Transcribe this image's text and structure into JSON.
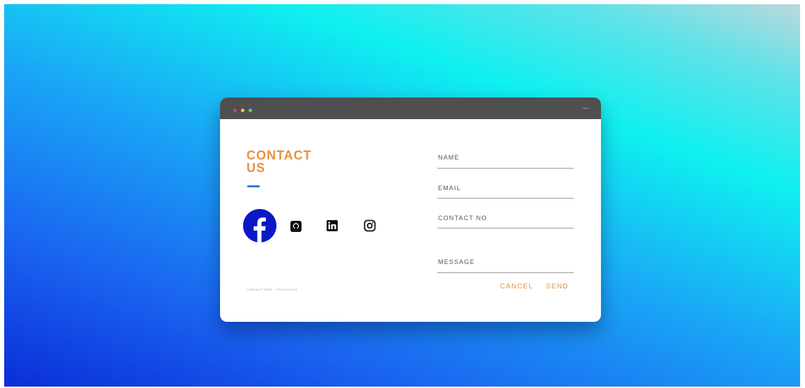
{
  "window": {
    "title_dots": [
      "red",
      "yellow",
      "green"
    ]
  },
  "contact": {
    "heading_line1": "CONTACT",
    "heading_line2": "US",
    "info_text": "CONTACT INFO : +91XXXXXXX"
  },
  "social": [
    {
      "name": "facebook",
      "icon": "facebook-icon"
    },
    {
      "name": "github",
      "icon": "github-icon"
    },
    {
      "name": "linkedin",
      "icon": "linkedin-icon"
    },
    {
      "name": "instagram",
      "icon": "instagram-icon"
    }
  ],
  "form": {
    "name_label": "NAME",
    "email_label": "EMAIL",
    "contact_label": "CONTACT NO",
    "message_label": "MESSAGE",
    "cancel_label": "CANCEL",
    "send_label": "SEND"
  },
  "colors": {
    "accent": "#e8913c",
    "titlebar": "#4f4f4f",
    "facebook": "#0a18c8",
    "underline": "#2c7fd6"
  }
}
